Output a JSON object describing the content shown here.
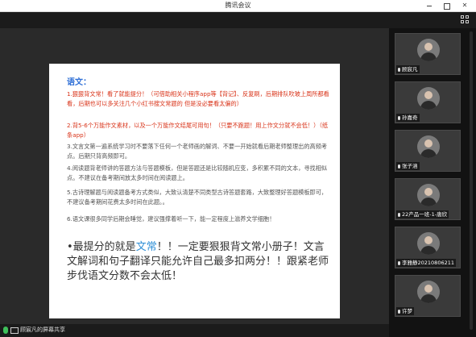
{
  "window": {
    "title": "腾讯会议"
  },
  "slide": {
    "heading": "语文：",
    "items": [
      "1.狠狠背文常！看了就能提分！（可借助相关小程序app等【背记】、反复刷，后期排队吹玻上周所都看看，后期也可以多关注几个小红书搜文常题的 但是没必要看太偏的）",
      "2.背5-6个万能作文素材，以及一个万能作文结尾可用句！（只要不跑题！用上作文分就不会低！）（纸条app）",
      "3.文言文第一遍系统学习时不要落下任何一个老师画的解词、不要一开始就看后期老师整理出的高频考点。后期只背高频即可。",
      "4.阅读题背老师讲的答题方法与答题模板，但是答题还是比较随机应变，多积累不同的文本，寻找相似点。不建议在备考期间放太多时间在阅读题上。",
      "5.古诗理解题与阅读题备考方式类似，大致认清楚不同类型古诗答题套路，大致整理好答题模板即可，不建议备考期间花费太多时间在此题。。",
      "6.语文课很多同学后期会睡觉，建议强撑着听一下，能一定程度上滋养文学细胞！"
    ],
    "big_pre": "最提分的就是",
    "big_hl": "文常",
    "big_post": "！！一定要狠狠背文常小册子！文言文解词和句子翻译只能允许自己最多扣两分！！跟紧老师步伐语文分数不会太低！"
  },
  "status": {
    "share_text": "顾宸凡的屏幕共享"
  },
  "participants": [
    {
      "name": "顾宸凡"
    },
    {
      "name": "孙嘉奇"
    },
    {
      "name": "张子涵"
    },
    {
      "name": "22产品一班-1-唐欣"
    },
    {
      "name": "李雅静20210806211"
    },
    {
      "name": "许梦"
    }
  ]
}
